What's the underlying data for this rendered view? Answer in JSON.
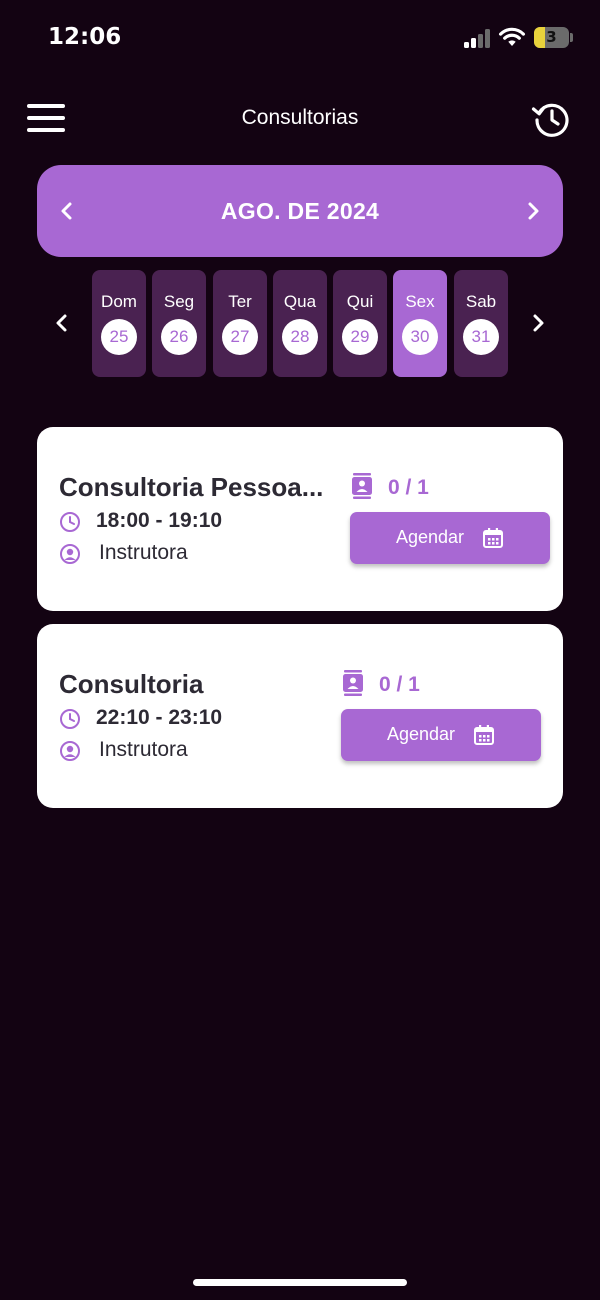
{
  "status_bar": {
    "time": "12:06",
    "battery_level": "3"
  },
  "header": {
    "title": "Consultorias",
    "menu_icon": "menu-icon",
    "history_icon": "history-icon"
  },
  "calendar": {
    "month_label": "AGO. DE 2024",
    "days": [
      {
        "name": "Dom",
        "date": "25",
        "selected": false
      },
      {
        "name": "Seg",
        "date": "26",
        "selected": false
      },
      {
        "name": "Ter",
        "date": "27",
        "selected": false
      },
      {
        "name": "Qua",
        "date": "28",
        "selected": false
      },
      {
        "name": "Qui",
        "date": "29",
        "selected": false
      },
      {
        "name": "Sex",
        "date": "30",
        "selected": true
      },
      {
        "name": "Sab",
        "date": "31",
        "selected": false
      }
    ]
  },
  "sessions": [
    {
      "title": "Consultoria Pessoa...",
      "time": "18:00 - 19:10",
      "instructor": "Instrutora",
      "capacity": "0 / 1",
      "book_label": "Agendar"
    },
    {
      "title": "Consultoria",
      "time": "22:10 - 23:10",
      "instructor": "Instrutora",
      "capacity": "0 / 1",
      "book_label": "Agendar"
    }
  ],
  "colors": {
    "background": "#130312",
    "accent": "#a868d3",
    "day_bg": "#4a2251",
    "card_bg": "#ffffff",
    "text_dark": "#2d2a34"
  }
}
